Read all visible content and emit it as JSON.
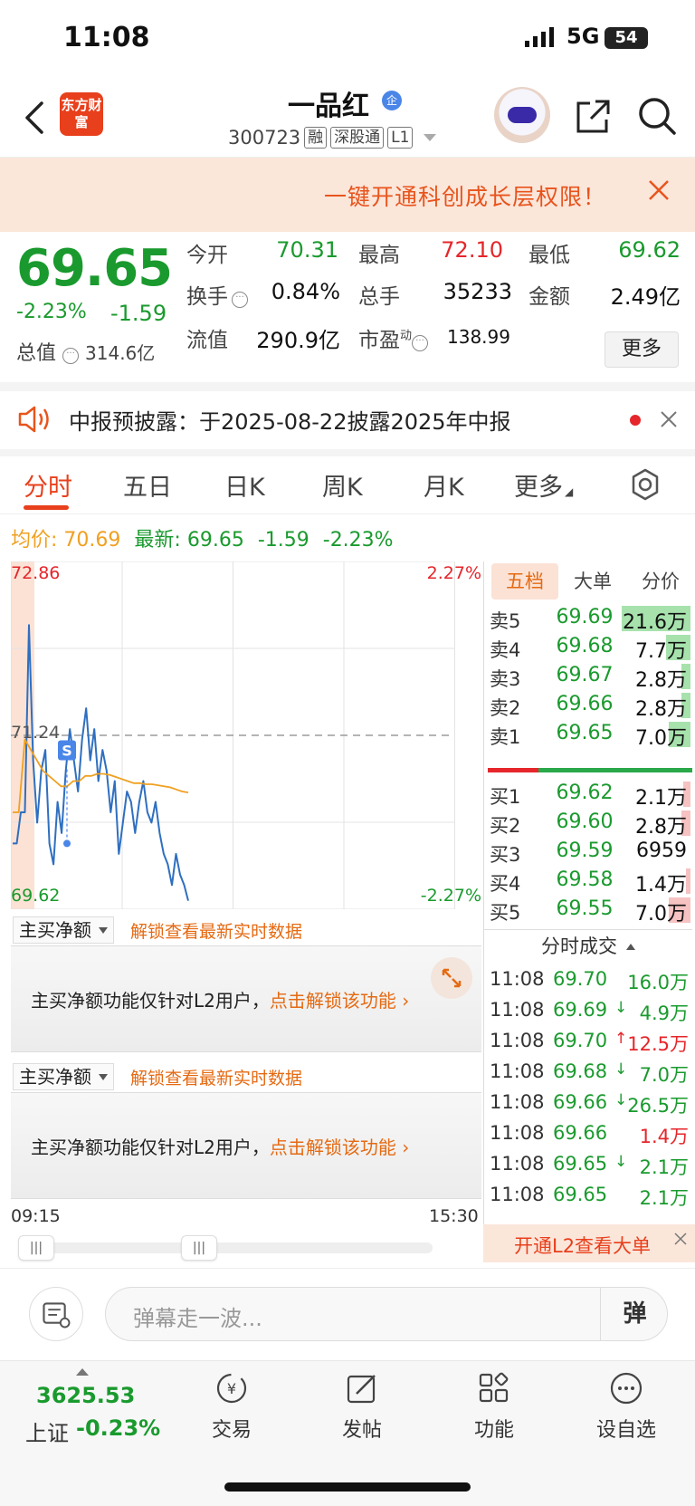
{
  "status": {
    "time": "11:08",
    "network": "5G",
    "battery": "54"
  },
  "header": {
    "logo_text": "东方财富",
    "title": "一品红",
    "badge": "企",
    "code": "300723",
    "tags": [
      "融",
      "深股通",
      "L1"
    ]
  },
  "promo": {
    "text": "一键开通科创成长层权限！"
  },
  "quote": {
    "price": "69.65",
    "change_pct": "-2.23%",
    "change": "-1.59",
    "market_cap_label": "总值",
    "market_cap": "314.6亿",
    "fields": {
      "open_label": "今开",
      "open": "70.31",
      "high_label": "最高",
      "high": "72.10",
      "low_label": "最低",
      "low": "69.62",
      "turnover_label": "换手",
      "turnover": "0.84%",
      "volume_label": "总手",
      "volume": "35233",
      "amount_label": "金额",
      "amount": "2.49亿",
      "float_cap_label": "流值",
      "float_cap": "290.9亿",
      "pe_label": "市盈",
      "pe_sup": "动",
      "pe": "138.99"
    },
    "more_label": "更多"
  },
  "notice": {
    "text": "中报预披露：于2025-08-22披露2025年中报"
  },
  "tabs": [
    "分时",
    "五日",
    "日K",
    "周K",
    "月K",
    "更多"
  ],
  "avg_row": {
    "avg_label": "均价:",
    "avg_value": "70.69",
    "latest_label": "最新:",
    "latest_value": "69.65",
    "change": "-1.59",
    "change_pct": "-2.23%"
  },
  "chart_labels": {
    "max_price": "72.86",
    "mid_price": "71.24",
    "min_price": "69.62",
    "max_pct": "2.27%",
    "min_pct": "-2.27%",
    "marker": "S",
    "time_start": "09:15",
    "time_end": "15:30"
  },
  "chart_data": {
    "type": "line",
    "ylim": [
      69.62,
      72.86
    ],
    "reference": 71.24,
    "series": [
      {
        "values": [
          70.2,
          70.2,
          70.5,
          70.5,
          72.3,
          71.0,
          70.4,
          70.9,
          71.1,
          70.2,
          70.0,
          70.6,
          70.3,
          70.9,
          71.3,
          71.0,
          70.7,
          71.2,
          71.5,
          71.0,
          71.3,
          70.8,
          71.1,
          70.9,
          70.5,
          70.8,
          70.1,
          70.4,
          70.7,
          70.6,
          70.3,
          70.6,
          70.8,
          70.5,
          70.4,
          70.6,
          70.3,
          70.1,
          70.0,
          69.8,
          70.1,
          69.9,
          69.8,
          69.65
        ]
      },
      {
        "values": [
          70.5,
          70.5,
          71.2,
          71.1,
          71.0,
          70.9,
          70.85,
          70.8,
          70.75,
          70.75,
          70.8,
          70.8,
          70.85,
          70.85,
          70.87,
          70.87,
          70.86,
          70.84,
          70.82,
          70.8,
          70.78,
          70.78,
          70.77,
          70.77,
          70.76,
          70.75,
          70.74,
          70.72,
          70.7,
          70.69
        ]
      }
    ]
  },
  "panels": [
    {
      "select": "主买净额",
      "link": "解锁查看最新实时数据",
      "msg": "主买净额功能仅针对L2用户，",
      "msg_link": "点击解锁该功能"
    },
    {
      "select": "主买净额",
      "link": "解锁查看最新实时数据",
      "msg": "主买净额功能仅针对L2用户，",
      "msg_link": "点击解锁该功能"
    }
  ],
  "book": {
    "tabs": [
      "五档",
      "大单",
      "分价"
    ],
    "asks": [
      {
        "label": "卖5",
        "price": "69.69",
        "vol": "21.6万",
        "share": 1.0
      },
      {
        "label": "卖4",
        "price": "69.68",
        "vol": "7.7万",
        "share": 0.36
      },
      {
        "label": "卖3",
        "price": "69.67",
        "vol": "2.8万",
        "share": 0.13
      },
      {
        "label": "卖2",
        "price": "69.66",
        "vol": "2.8万",
        "share": 0.13
      },
      {
        "label": "卖1",
        "price": "69.65",
        "vol": "7.0万",
        "share": 0.32
      }
    ],
    "bids": [
      {
        "label": "买1",
        "price": "69.62",
        "vol": "2.1万",
        "share": 0.1
      },
      {
        "label": "买2",
        "price": "69.60",
        "vol": "2.8万",
        "share": 0.13
      },
      {
        "label": "买3",
        "price": "69.59",
        "vol": "6959",
        "share": 0.0
      },
      {
        "label": "买4",
        "price": "69.58",
        "vol": "1.4万",
        "share": 0.06
      },
      {
        "label": "买5",
        "price": "69.55",
        "vol": "7.0万",
        "share": 0.32
      }
    ],
    "fenshi_title": "分时成交",
    "trades": [
      {
        "time": "11:08",
        "price": "69.70",
        "arrow": "",
        "vol": "16.0万",
        "dir": "green"
      },
      {
        "time": "11:08",
        "price": "69.69",
        "arrow": "↓",
        "vol": "4.9万",
        "dir": "green"
      },
      {
        "time": "11:08",
        "price": "69.70",
        "arrow": "↑",
        "vol": "12.5万",
        "dir": "red"
      },
      {
        "time": "11:08",
        "price": "69.68",
        "arrow": "↓",
        "vol": "7.0万",
        "dir": "green"
      },
      {
        "time": "11:08",
        "price": "69.66",
        "arrow": "↓",
        "vol": "26.5万",
        "dir": "green"
      },
      {
        "time": "11:08",
        "price": "69.66",
        "arrow": "",
        "vol": "1.4万",
        "dir": "red"
      },
      {
        "time": "11:08",
        "price": "69.65",
        "arrow": "↓",
        "vol": "2.1万",
        "dir": "green"
      },
      {
        "time": "11:08",
        "price": "69.65",
        "arrow": "",
        "vol": "2.1万",
        "dir": "green"
      }
    ],
    "l2_banner": "开通L2查看大单"
  },
  "danmu": {
    "placeholder": "弹幕走一波...",
    "send": "弹"
  },
  "bottom": {
    "index_value": "3625.53",
    "index_name": "上证",
    "index_pct": "-0.23%",
    "nav": [
      "交易",
      "发帖",
      "功能",
      "设自选"
    ]
  },
  "colors": {
    "up": "#e5262b",
    "down": "#1a9a2e",
    "accent": "#e8401c",
    "price_line": "#2f6fc0",
    "avg_line": "#f0a020"
  }
}
